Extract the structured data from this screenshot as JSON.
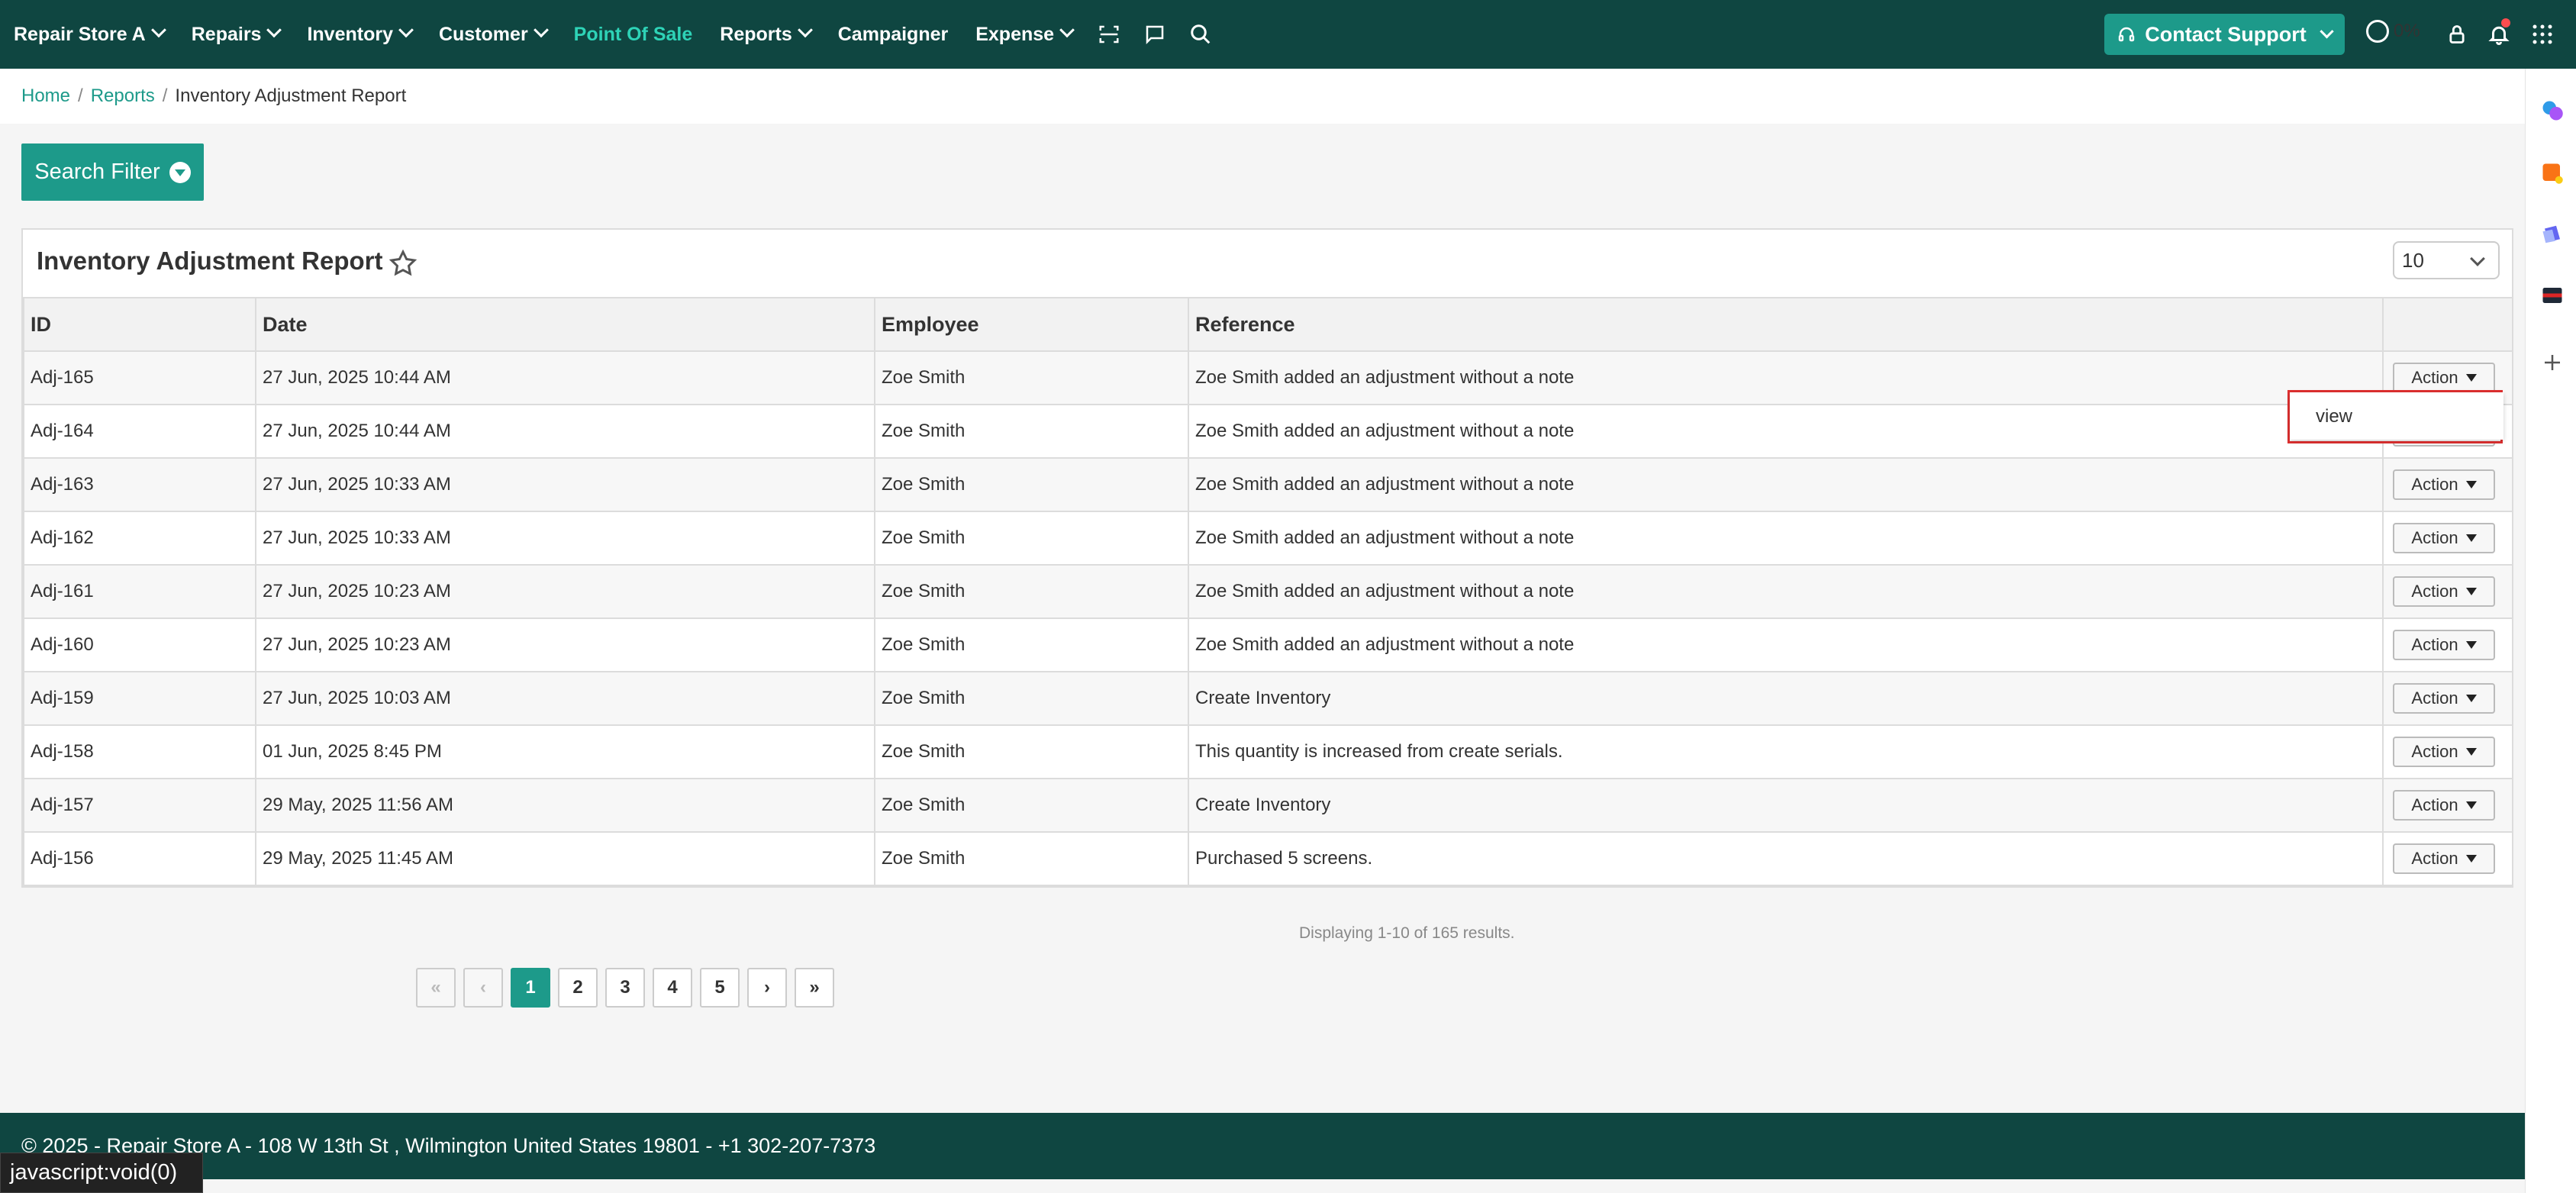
{
  "nav": {
    "items": [
      {
        "label": "Repair Store A",
        "dropdown": true
      },
      {
        "label": "Repairs",
        "dropdown": true
      },
      {
        "label": "Inventory",
        "dropdown": true
      },
      {
        "label": "Customer",
        "dropdown": true
      },
      {
        "label": "Point Of Sale",
        "dropdown": false,
        "active": true
      },
      {
        "label": "Reports",
        "dropdown": true
      },
      {
        "label": "Campaigner",
        "dropdown": false
      },
      {
        "label": "Expense",
        "dropdown": true
      }
    ],
    "contact_support": "Contact Support",
    "progress": "0%"
  },
  "breadcrumb": {
    "home": "Home",
    "reports": "Reports",
    "current": "Inventory Adjustment Report"
  },
  "search_filter": "Search Filter",
  "card": {
    "title": "Inventory Adjustment Report",
    "page_size": "10",
    "columns": [
      "ID",
      "Date",
      "Employee",
      "Reference",
      ""
    ],
    "action_label": "Action",
    "rows": [
      {
        "id": "Adj-165",
        "date": "27 Jun, 2025 10:44 AM",
        "employee": "Zoe Smith",
        "reference": "Zoe Smith added an adjustment without a note"
      },
      {
        "id": "Adj-164",
        "date": "27 Jun, 2025 10:44 AM",
        "employee": "Zoe Smith",
        "reference": "Zoe Smith added an adjustment without a note"
      },
      {
        "id": "Adj-163",
        "date": "27 Jun, 2025 10:33 AM",
        "employee": "Zoe Smith",
        "reference": "Zoe Smith added an adjustment without a note"
      },
      {
        "id": "Adj-162",
        "date": "27 Jun, 2025 10:33 AM",
        "employee": "Zoe Smith",
        "reference": "Zoe Smith added an adjustment without a note"
      },
      {
        "id": "Adj-161",
        "date": "27 Jun, 2025 10:23 AM",
        "employee": "Zoe Smith",
        "reference": "Zoe Smith added an adjustment without a note"
      },
      {
        "id": "Adj-160",
        "date": "27 Jun, 2025 10:23 AM",
        "employee": "Zoe Smith",
        "reference": "Zoe Smith added an adjustment without a note"
      },
      {
        "id": "Adj-159",
        "date": "27 Jun, 2025 10:03 AM",
        "employee": "Zoe Smith",
        "reference": "Create Inventory"
      },
      {
        "id": "Adj-158",
        "date": "01 Jun, 2025 8:45 PM",
        "employee": "Zoe Smith",
        "reference": "This quantity is increased from create serials."
      },
      {
        "id": "Adj-157",
        "date": "29 May, 2025 11:56 AM",
        "employee": "Zoe Smith",
        "reference": "Create Inventory"
      },
      {
        "id": "Adj-156",
        "date": "29 May, 2025 11:45 AM",
        "employee": "Zoe Smith",
        "reference": "Purchased 5 screens."
      }
    ],
    "dropdown_view": "view"
  },
  "summary": "Displaying 1-10 of 165 results.",
  "pager": {
    "first": "«",
    "prev": "‹",
    "pages": [
      "1",
      "2",
      "3",
      "4",
      "5"
    ],
    "current": "1",
    "next": "›",
    "last": "»"
  },
  "footer": "© 2025 - Repair Store A - 108 W 13th St , Wilmington United States 19801 - +1 302-207-7373",
  "status_url": "javascript:void(0)",
  "colors": {
    "nav_bg": "#0f4641",
    "accent": "#1d9a8a",
    "active_nav": "#2ed3b7",
    "highlight_box": "#e03030"
  }
}
